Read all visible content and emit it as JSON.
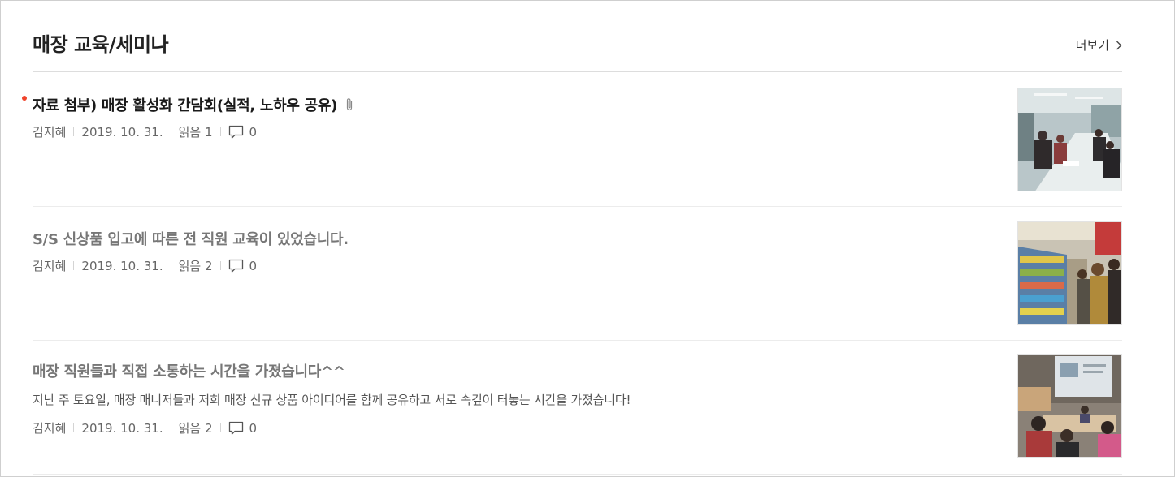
{
  "board": {
    "title": "매장 교육/세미나",
    "more_label": "더보기",
    "more_icon": "chevron-right-icon"
  },
  "posts": [
    {
      "subject": "자료 첨부) 매장 활성화 간담회(실적, 노하우 공유)",
      "is_new": true,
      "has_attachment": true,
      "author": "김지혜",
      "date": "2019. 10. 31.",
      "views": "읽음 1",
      "comments": "0",
      "thumbnail": "meeting-room-photo"
    },
    {
      "subject": "S/S 신상품 입고에 따른 전 직원 교육이 있었습니다.",
      "is_new": false,
      "has_attachment": false,
      "author": "김지혜",
      "date": "2019. 10. 31.",
      "views": "읽음 2",
      "comments": "0",
      "thumbnail": "store-shelf-photo"
    },
    {
      "subject": "매장 직원들과 직접 소통하는 시간을 가졌습니다^^",
      "summary": "지난 주 토요일, 매장 매니저들과 저희 매장 신규 상품 아이디어를 함께 공유하고 서로 속깊이 터놓는 시간을 가졌습니다!",
      "is_new": false,
      "has_attachment": false,
      "author": "김지혜",
      "date": "2019. 10. 31.",
      "views": "읽음 2",
      "comments": "0",
      "thumbnail": "seminar-presentation-photo"
    }
  ],
  "colors": {
    "new_dot": "#f0432b",
    "unread_title": "#1a1a1a",
    "read_title": "#777777",
    "divider": "#dddddd"
  }
}
